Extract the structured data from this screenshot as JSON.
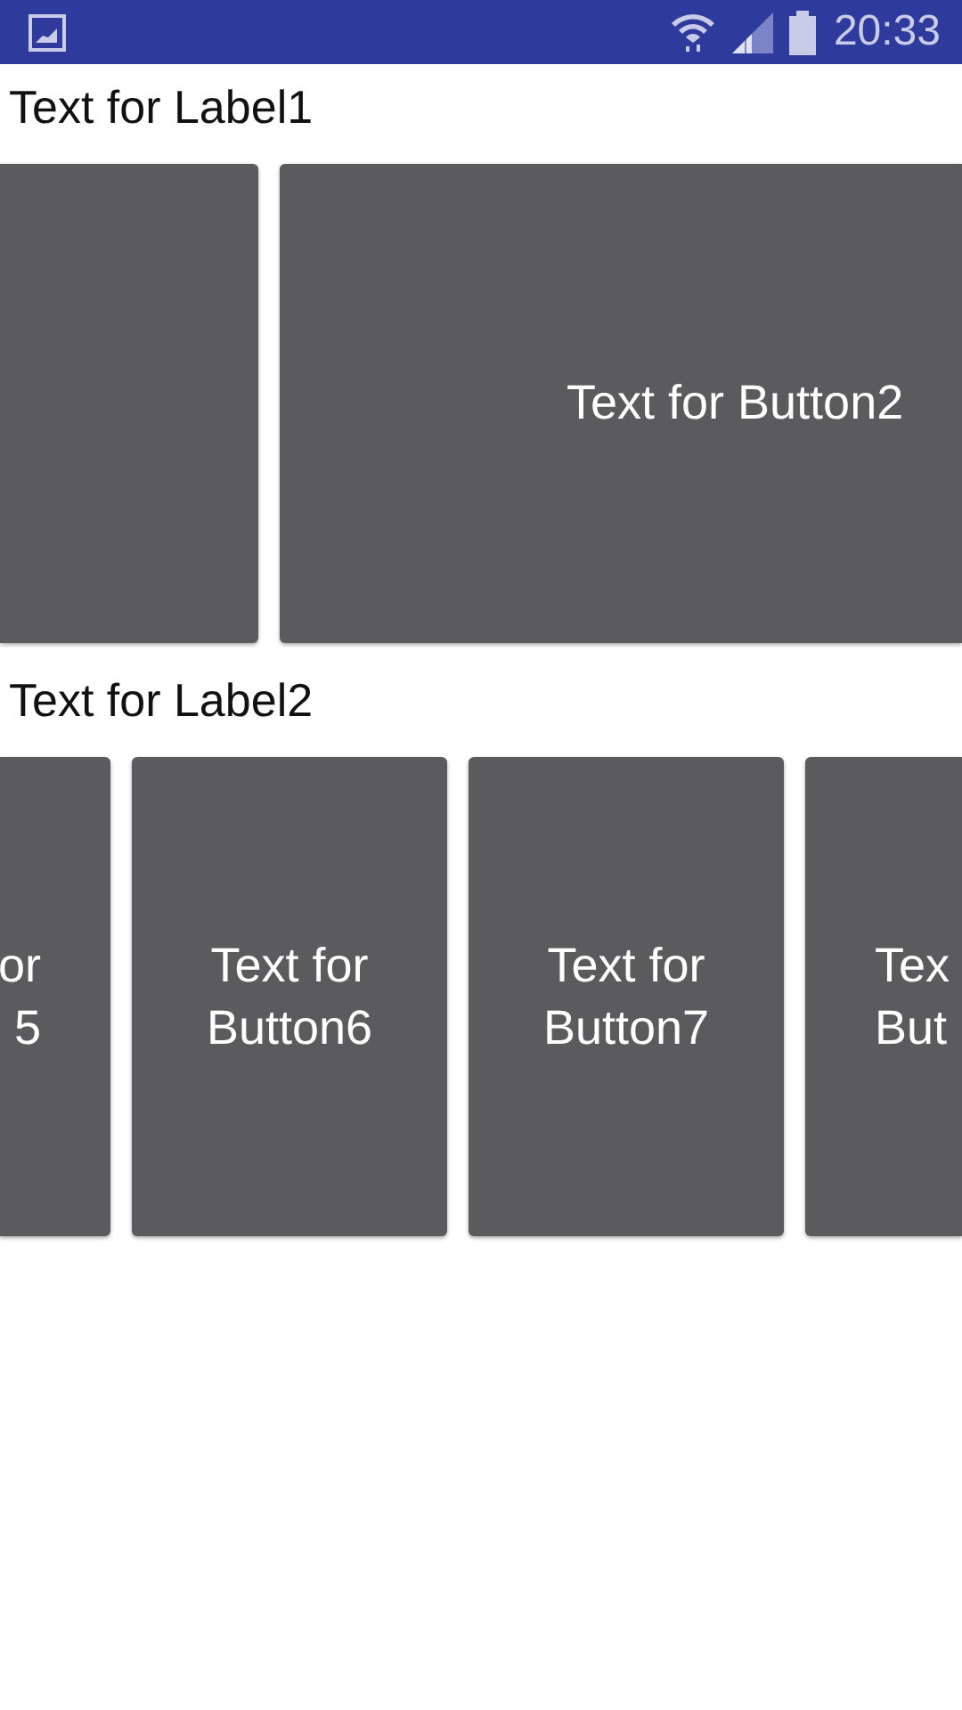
{
  "status_bar": {
    "time": "20:33"
  },
  "sections": [
    {
      "label": "Text for Label1",
      "buttons": [
        {
          "kind": "cut_left"
        },
        {
          "kind": "cut_right",
          "lines": [
            "Text for Button2"
          ]
        }
      ]
    },
    {
      "label": "Text for Label2",
      "buttons": [
        {
          "kind": "cut_left",
          "lines": [
            "or",
            "5"
          ]
        },
        {
          "kind": "full",
          "lines": [
            "Text for",
            "Button6"
          ]
        },
        {
          "kind": "full",
          "lines": [
            "Text for",
            "Button7"
          ]
        },
        {
          "kind": "cut_right",
          "lines": [
            "Tex",
            "But"
          ]
        }
      ]
    }
  ]
}
